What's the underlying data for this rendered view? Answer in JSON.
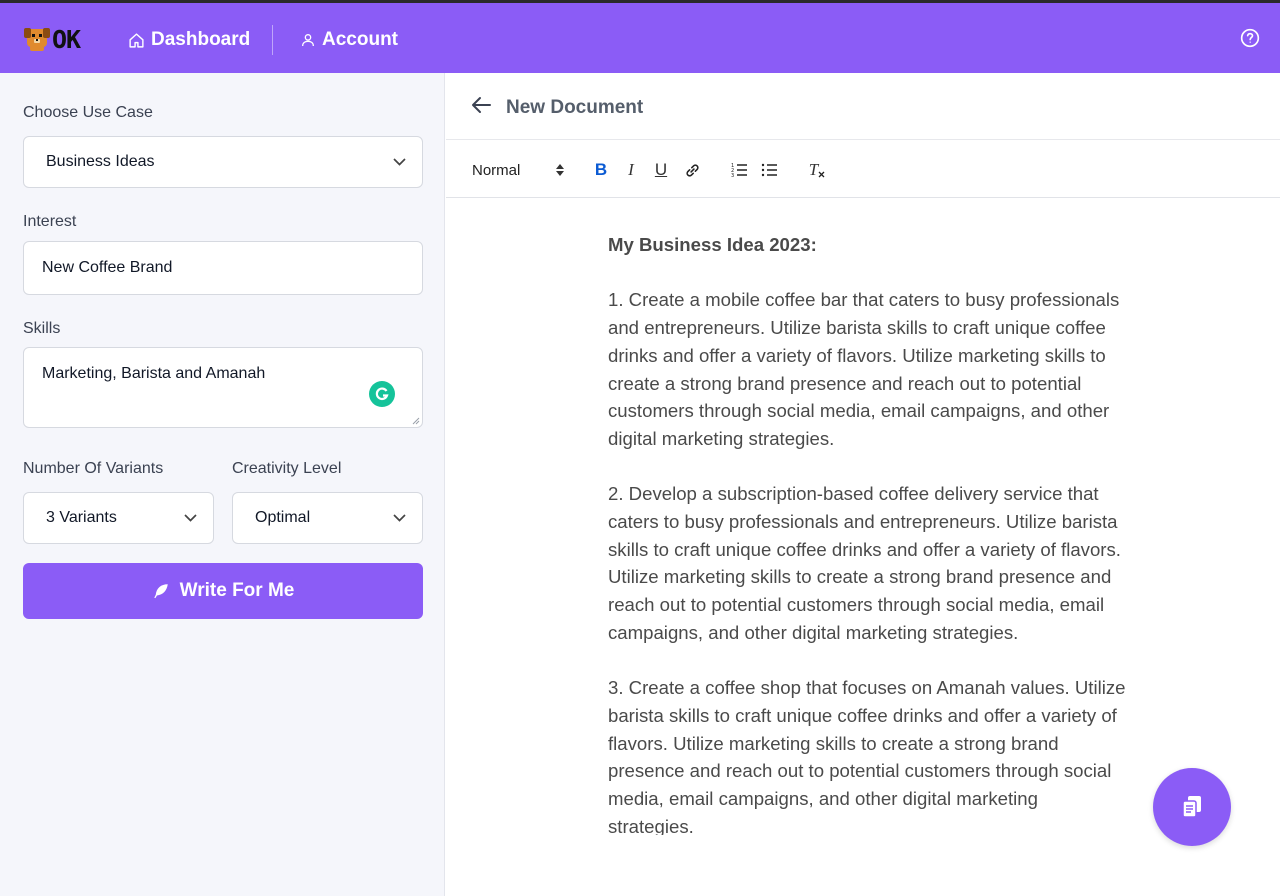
{
  "header": {
    "logo_text": "OK",
    "nav": [
      {
        "label": "Dashboard",
        "icon": "home-icon"
      },
      {
        "label": "Account",
        "icon": "user-icon"
      }
    ],
    "help_icon": "help-circle-icon",
    "background_color": "#8b5cf6"
  },
  "form": {
    "use_case": {
      "label": "Choose Use Case",
      "value": "Business Ideas"
    },
    "interest": {
      "label": "Interest",
      "value": "New Coffee Brand"
    },
    "skills": {
      "label": "Skills",
      "value": "Marketing, Barista and Amanah"
    },
    "variants": {
      "label": "Number Of Variants",
      "value": "3 Variants"
    },
    "creativity": {
      "label": "Creativity Level",
      "value": "Optimal"
    },
    "submit_label": "Write For Me"
  },
  "document": {
    "title": "New Document",
    "toolbar": {
      "format": "Normal",
      "bold": "B",
      "italic": "I",
      "underline": "U",
      "clear": "T"
    },
    "heading": "My Business Idea 2023:",
    "paragraphs": [
      "1. Create a mobile coffee bar that caters to busy professionals and entrepreneurs. Utilize barista skills to craft unique coffee drinks and offer a variety of flavors. Utilize marketing skills to create a strong brand presence and reach out to potential customers through social media, email campaigns, and other digital marketing strategies.",
      "2. Develop a subscription-based coffee delivery service that caters to busy professionals and entrepreneurs. Utilize barista skills to craft unique coffee drinks and offer a variety of flavors. Utilize marketing skills to create a strong brand presence and reach out to potential customers through social media, email campaigns, and other digital marketing strategies.",
      "3. Create a coffee shop that focuses on Amanah values. Utilize barista skills to craft unique coffee drinks and offer a variety of flavors. Utilize marketing skills to create a strong brand presence and reach out to potential customers through social media, email campaigns, and other digital marketing strategies."
    ]
  }
}
